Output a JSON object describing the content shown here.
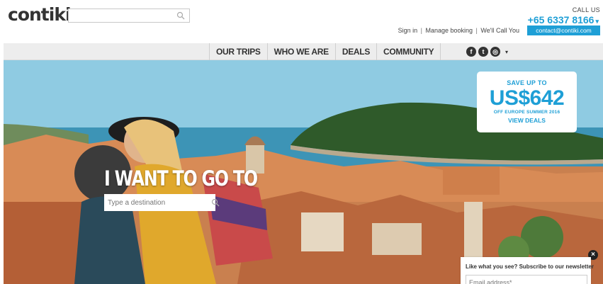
{
  "header": {
    "logo": "contiki",
    "search": {
      "placeholder": "",
      "value": ""
    },
    "call_us": "CALL US",
    "phone": "+65 6337 8166",
    "phone_caret": "▾",
    "links": [
      "Sign in",
      "Manage booking",
      "We'll Call You"
    ],
    "link_separator": "|",
    "contact_button": "contact@contiki.com"
  },
  "nav": {
    "items": [
      "OUR TRIPS",
      "WHO WE ARE",
      "DEALS",
      "COMMUNITY"
    ],
    "social": [
      {
        "icon": "facebook-icon",
        "glyph": "f"
      },
      {
        "icon": "twitter-icon",
        "glyph": "t"
      },
      {
        "icon": "instagram-icon",
        "glyph": "◎"
      }
    ],
    "social_dropdown": "▾"
  },
  "hero": {
    "heading": "I WANT TO GO TO",
    "destination": {
      "placeholder": "Type a destination",
      "value": ""
    }
  },
  "deal": {
    "save": "SAVE UP TO",
    "amount": "US$642",
    "subtitle": "OFF EUROPE SUMMER 2016",
    "cta": "VIEW DEALS"
  },
  "newsletter": {
    "title": "Like what you see? Subscribe to our newsletter",
    "email_placeholder": "Email address*",
    "close_glyph": "×"
  },
  "colors": {
    "accent": "#1e9fd6",
    "nav_bg": "#ededed",
    "text": "#333333"
  }
}
